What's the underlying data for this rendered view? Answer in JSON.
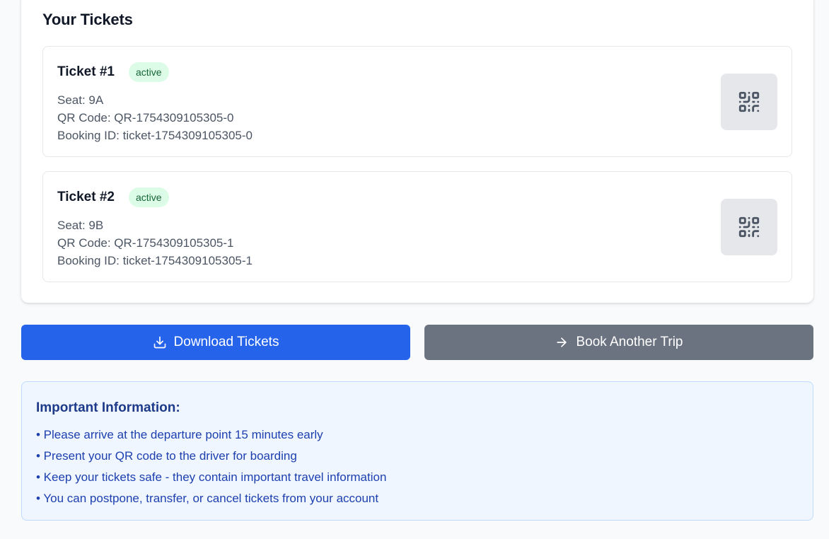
{
  "tickets_section": {
    "title": "Your Tickets",
    "tickets": [
      {
        "name": "Ticket #1",
        "status": "active",
        "seat": "Seat: 9A",
        "qr_code": "QR Code: QR-1754309105305-0",
        "booking_id": "Booking ID: ticket-1754309105305-0",
        "icon": "qr-code-icon"
      },
      {
        "name": "Ticket #2",
        "status": "active",
        "seat": "Seat: 9B",
        "qr_code": "QR Code: QR-1754309105305-1",
        "booking_id": "Booking ID: ticket-1754309105305-1",
        "icon": "qr-code-icon"
      }
    ]
  },
  "actions": {
    "download_label": "Download Tickets",
    "download_icon": "download-icon",
    "book_label": "Book Another Trip",
    "book_icon": "arrow-right-icon"
  },
  "info": {
    "title": "Important Information:",
    "items": [
      "• Please arrive at the departure point 15 minutes early",
      "• Present your QR code to the driver for boarding",
      "• Keep your tickets safe - they contain important travel information",
      "• You can postpone, transfer, or cancel tickets from your account"
    ]
  },
  "colors": {
    "primary": "#2563eb",
    "secondary": "#6b7280",
    "badge_bg": "#dcfce7",
    "badge_text": "#166534",
    "info_bg": "#eff6ff",
    "info_text": "#1e40af"
  }
}
